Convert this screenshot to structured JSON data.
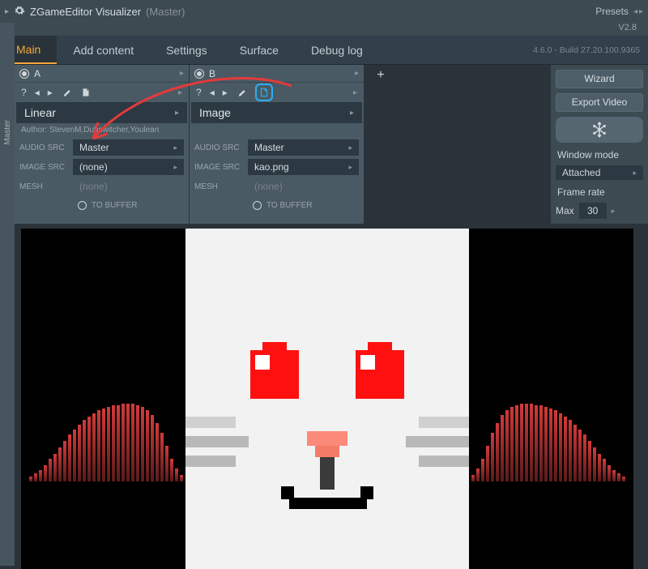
{
  "titlebar": {
    "app_name": "ZGameEditor Visualizer",
    "context": "(Master)",
    "presets_label": "Presets"
  },
  "version": "V2.8",
  "build": "4.6.0 - Build 27.20.100.9365",
  "tabs": [
    "Main",
    "Add content",
    "Settings",
    "Surface",
    "Debug log"
  ],
  "active_tab": 0,
  "layers": [
    {
      "id": "A",
      "active": true,
      "effect": "Linear",
      "author": "Author: StevenM,Dubswitcher,Youlean",
      "audio_src": "Master",
      "image_src": "(none)",
      "mesh": "(none)",
      "to_buffer_label": "TO BUFFER",
      "highlight_clip": false
    },
    {
      "id": "B",
      "active": true,
      "effect": "Image",
      "author": "",
      "audio_src": "Master",
      "image_src": "kao.png",
      "mesh": "(none)",
      "to_buffer_label": "TO BUFFER",
      "highlight_clip": true
    }
  ],
  "prop_labels": {
    "audio": "AUDIO SRC",
    "image": "IMAGE SRC",
    "mesh": "MESH"
  },
  "sidepanel": {
    "wizard": "Wizard",
    "export": "Export Video",
    "window_mode_label": "Window mode",
    "window_mode_value": "Attached",
    "frame_rate_label": "Frame rate",
    "frame_rate_max_label": "Max",
    "frame_rate_value": "30"
  },
  "leftstrip": {
    "label": "Master"
  }
}
